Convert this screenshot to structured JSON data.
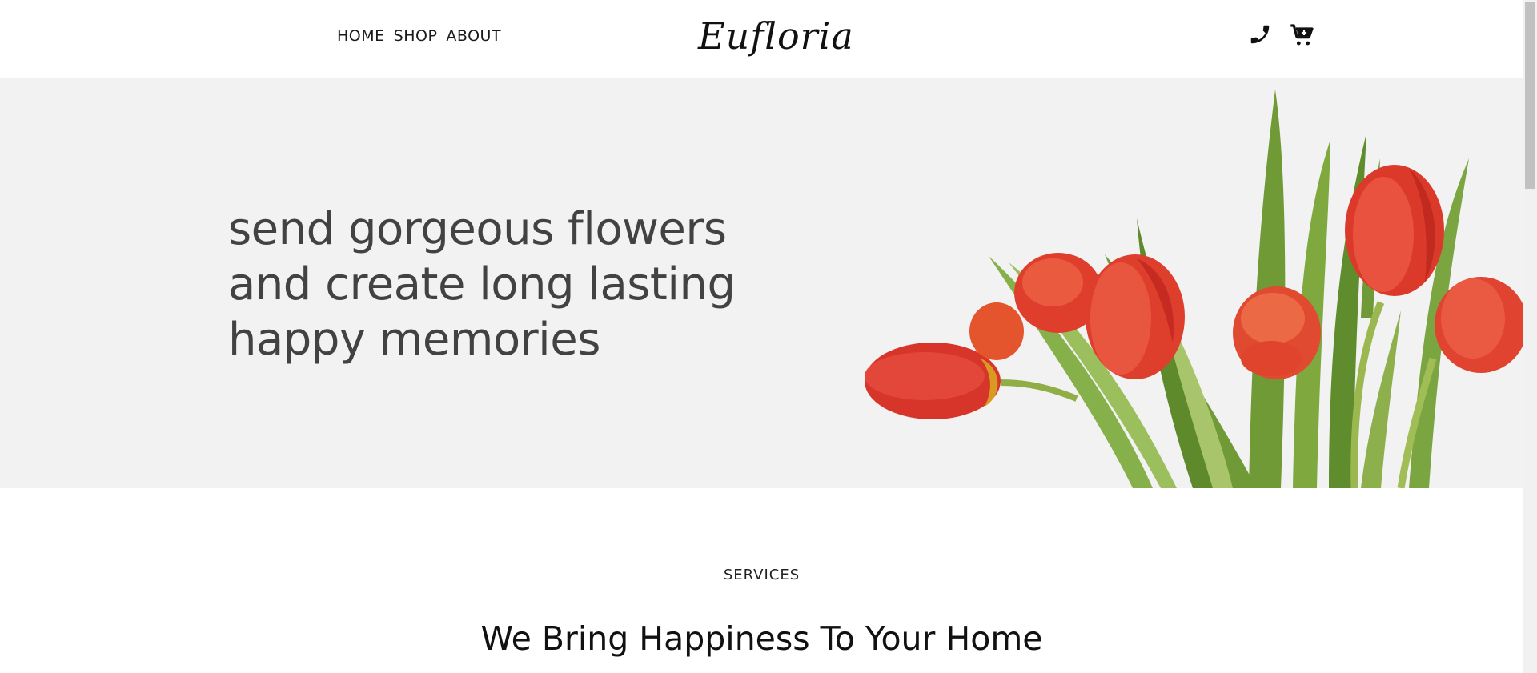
{
  "header": {
    "nav": [
      {
        "label": "HOME"
      },
      {
        "label": "SHOP"
      },
      {
        "label": "ABOUT"
      }
    ],
    "logo": "Eufloria",
    "icons": {
      "phone": "phone-icon",
      "cart": "cart-icon"
    }
  },
  "hero": {
    "lines": [
      "send gorgeous flowers",
      "and create long lasting",
      "happy memories"
    ],
    "background": "#f2f2f2",
    "image": "red-tulips-bouquet"
  },
  "services": {
    "label": "SERVICES",
    "title": "We Bring Happiness To Your Home"
  }
}
